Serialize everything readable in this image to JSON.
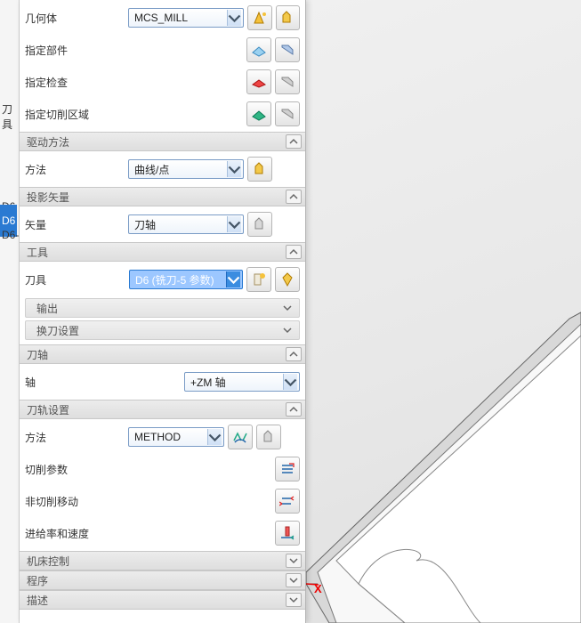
{
  "left_strip": {
    "header": "刀具",
    "rows": [
      "D6",
      "D6",
      "D6-"
    ],
    "selected_index": 1
  },
  "viewport": {
    "axis_x": "X"
  },
  "geometry": {
    "label_body": "几何体",
    "body_value": "MCS_MILL",
    "label_part": "指定部件",
    "label_check": "指定检查",
    "label_cut_area": "指定切削区域"
  },
  "drive_method": {
    "header": "驱动方法",
    "label": "方法",
    "value": "曲线/点"
  },
  "projection_vector": {
    "header": "投影矢量",
    "label": "矢量",
    "value": "刀轴"
  },
  "tool": {
    "header": "工具",
    "label": "刀具",
    "value": "D6 (铣刀-5 参数)",
    "sub_output": "输出",
    "sub_change": "换刀设置"
  },
  "tool_axis": {
    "header": "刀轴",
    "label": "轴",
    "value": "+ZM 轴"
  },
  "path_settings": {
    "header": "刀轨设置",
    "label_method": "方法",
    "method_value": "METHOD",
    "label_cut_params": "切削参数",
    "label_noncut_moves": "非切削移动",
    "label_feeds": "进给率和速度"
  },
  "machine_control": {
    "header": "机床控制"
  },
  "program": {
    "header": "程序"
  },
  "desc": {
    "header": "描述"
  }
}
